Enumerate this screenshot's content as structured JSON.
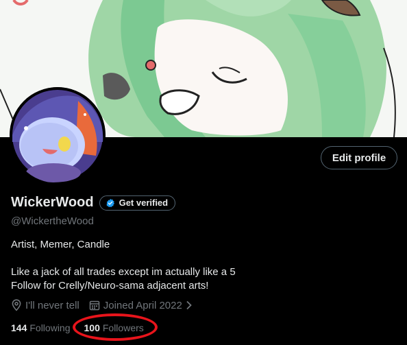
{
  "profile": {
    "display_name": "WickerWood",
    "handle": "@WickertheWood",
    "edit_profile_label": "Edit profile",
    "get_verified_label": "Get verified",
    "bio_line1": "Artist, Memer, Candle",
    "bio_line2": "Like a jack of all trades except im actually like a 5",
    "bio_line3": "Follow for Crelly/Neuro-sama adjacent arts!",
    "location": "I'll never tell",
    "joined": "Joined April 2022",
    "following_count": "144",
    "following_label": "Following",
    "followers_count": "100",
    "followers_label": "Followers"
  },
  "icons": {
    "location": "location-pin-icon",
    "calendar": "calendar-icon",
    "verified_badge": "verified-badge-icon",
    "chevron": "chevron-right-icon"
  },
  "colors": {
    "background": "#000000",
    "text_primary": "#e7e9ea",
    "text_secondary": "#71767b",
    "verified_blue": "#1d9bf0",
    "annotation_red": "#e8141b"
  }
}
